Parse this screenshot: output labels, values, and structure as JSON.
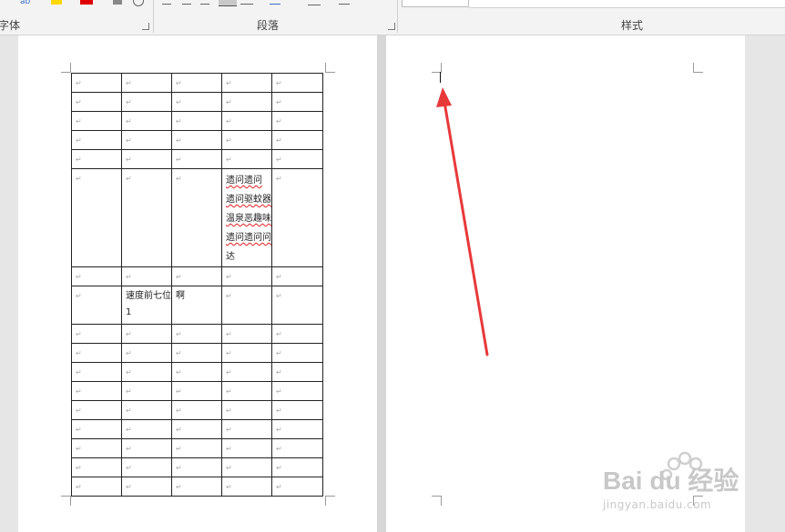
{
  "ribbon": {
    "groups": [
      {
        "label": "字体"
      },
      {
        "label": "段落"
      },
      {
        "label": "样式"
      }
    ]
  },
  "table": {
    "empty_mark": "↵",
    "rows": [
      [
        "",
        "",
        "",
        "",
        ""
      ],
      [
        "",
        "",
        "",
        "",
        ""
      ],
      [
        "",
        "",
        "",
        "",
        ""
      ],
      [
        "",
        "",
        "",
        "",
        ""
      ],
      [
        "",
        "",
        "",
        "",
        ""
      ],
      [
        "",
        "",
        "",
        "",
        ""
      ],
      [
        "",
        "",
        "",
        "",
        ""
      ],
      [
        "",
        "速度前七位1",
        "啊",
        "",
        ""
      ],
      [
        "",
        "",
        "",
        "",
        ""
      ],
      [
        "",
        "",
        "",
        "",
        ""
      ],
      [
        "",
        "",
        "",
        "",
        ""
      ],
      [
        "",
        "",
        "",
        "",
        ""
      ],
      [
        "",
        "",
        "",
        "",
        ""
      ],
      [
        "",
        "",
        "",
        "",
        ""
      ],
      [
        "",
        "",
        "",
        "",
        ""
      ],
      [
        "",
        "",
        "",
        "",
        ""
      ],
      [
        "",
        "",
        "",
        "",
        ""
      ]
    ],
    "tall_cell_lines": [
      "遗问遗问",
      "遗问驱蚊器",
      "温泉恶趣味",
      "遗问遗问问",
      "达"
    ]
  },
  "watermark": {
    "brand": "Bai du 经验",
    "url": "jingyan.baidu.com"
  },
  "colors": {
    "arrow": "#e8393a",
    "squiggle": "#e02020"
  }
}
